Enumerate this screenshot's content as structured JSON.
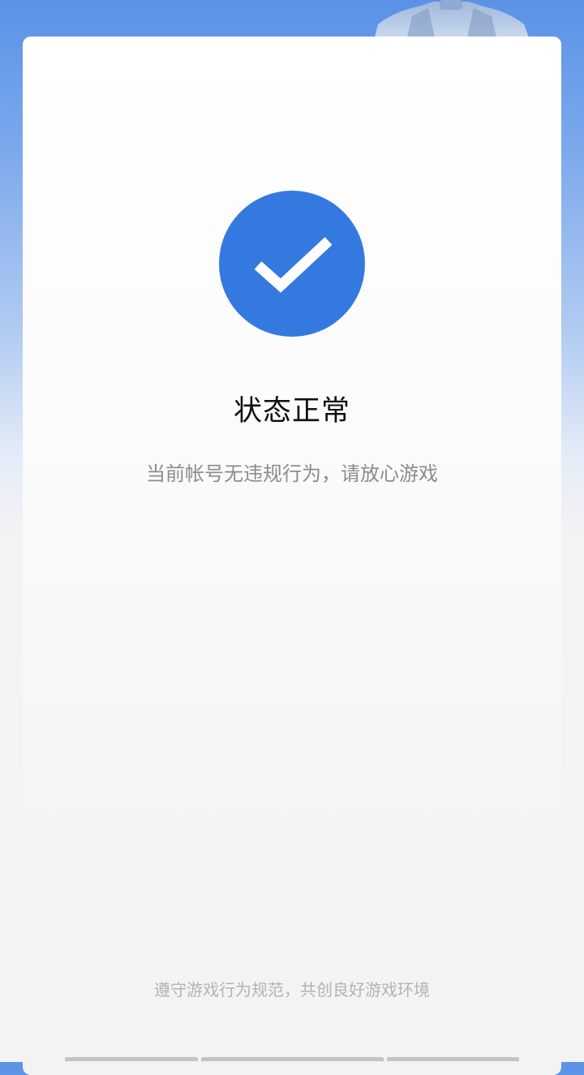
{
  "status": {
    "icon": "checkmark-icon",
    "title": "状态正常",
    "description": "当前帐号无违规行为，请放心游戏"
  },
  "footer": {
    "slogan": "遵守游戏行为规范，共创良好游戏环境"
  },
  "colors": {
    "accent": "#3479e0",
    "header_blue": "#5b92e6",
    "background": "#f3f3f4"
  }
}
